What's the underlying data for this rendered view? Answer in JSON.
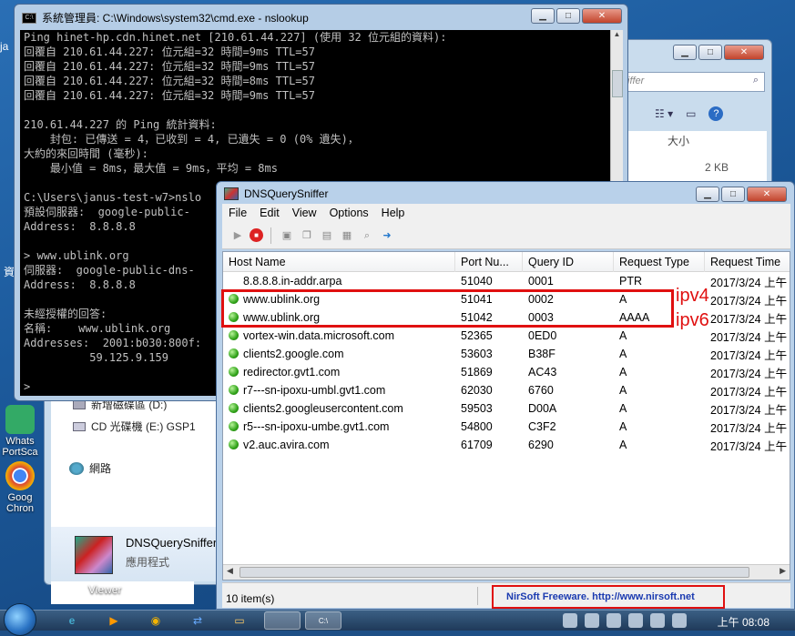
{
  "desktop": {
    "icons": [
      {
        "label": "Whats\nPortSca",
        "name": "whatsportscan-desktop-icon"
      },
      {
        "label": "Goog\nChron",
        "name": "google-chrome-desktop-icon"
      }
    ],
    "left_text": "ja",
    "left_text2": "資"
  },
  "explorer": {
    "search_placeholder": "iffer",
    "column_size": "大小",
    "size_value": "2 KB",
    "nav_items": [
      "新增磁碟區 (D:)",
      "CD 光碟機 (E:) GSP1",
      "網路"
    ],
    "detail_name": "DNSQuerySniffer",
    "detail_type": "應用程式",
    "viewer_label": "Viewer"
  },
  "cmd": {
    "title": "系統管理員: C:\\Windows\\system32\\cmd.exe - nslookup",
    "icon_text": "C:\\",
    "lines": [
      "Ping hinet-hp.cdn.hinet.net [210.61.44.227] (使用 32 位元組的資料):",
      "回覆自 210.61.44.227: 位元組=32 時間=9ms TTL=57",
      "回覆自 210.61.44.227: 位元組=32 時間=9ms TTL=57",
      "回覆自 210.61.44.227: 位元組=32 時間=8ms TTL=57",
      "回覆自 210.61.44.227: 位元組=32 時間=9ms TTL=57",
      "",
      "210.61.44.227 的 Ping 統計資料:",
      "    封包: 已傳送 = 4，已收到 = 4, 已遺失 = 0 (0% 遺失)，",
      "大約的來回時間 (毫秒):",
      "    最小值 = 8ms，最大值 = 9ms，平均 = 8ms",
      "",
      "C:\\Users\\janus-test-w7>nslo",
      "預設伺服器:  google-public-",
      "Address:  8.8.8.8",
      "",
      "> www.ublink.org",
      "伺服器:  google-public-dns-",
      "Address:  8.8.8.8",
      "",
      "未經授權的回答:",
      "名稱:    www.ublink.org",
      "Addresses:  2001:b030:800f:",
      "          59.125.9.159",
      "",
      ">"
    ]
  },
  "dqs": {
    "title": "DNSQuerySniffer",
    "menu": [
      "File",
      "Edit",
      "View",
      "Options",
      "Help"
    ],
    "columns": [
      "Host Name",
      "Port Nu...",
      "Query ID",
      "Request Type",
      "Request Time"
    ],
    "rows": [
      {
        "host": "8.8.8.8.in-addr.arpa",
        "port": "51040",
        "qid": "0001",
        "type": "PTR",
        "time": "2017/3/24 上午",
        "dot": false
      },
      {
        "host": "www.ublink.org",
        "port": "51041",
        "qid": "0002",
        "type": "A",
        "time": "2017/3/24 上午",
        "dot": true
      },
      {
        "host": "www.ublink.org",
        "port": "51042",
        "qid": "0003",
        "type": "AAAA",
        "time": "2017/3/24 上午",
        "dot": true
      },
      {
        "host": "vortex-win.data.microsoft.com",
        "port": "52365",
        "qid": "0ED0",
        "type": "A",
        "time": "2017/3/24 上午",
        "dot": true
      },
      {
        "host": "clients2.google.com",
        "port": "53603",
        "qid": "B38F",
        "type": "A",
        "time": "2017/3/24 上午",
        "dot": true
      },
      {
        "host": "redirector.gvt1.com",
        "port": "51869",
        "qid": "AC43",
        "type": "A",
        "time": "2017/3/24 上午",
        "dot": true
      },
      {
        "host": "r7---sn-ipoxu-umbl.gvt1.com",
        "port": "62030",
        "qid": "6760",
        "type": "A",
        "time": "2017/3/24 上午",
        "dot": true
      },
      {
        "host": "clients2.googleusercontent.com",
        "port": "59503",
        "qid": "D00A",
        "type": "A",
        "time": "2017/3/24 上午",
        "dot": true
      },
      {
        "host": "r5---sn-ipoxu-umbe.gvt1.com",
        "port": "54800",
        "qid": "C3F2",
        "type": "A",
        "time": "2017/3/24 上午",
        "dot": true
      },
      {
        "host": "v2.auc.avira.com",
        "port": "61709",
        "qid": "6290",
        "type": "A",
        "time": "2017/3/24 上午",
        "dot": true
      }
    ],
    "status_count": "10 item(s)",
    "nirsoft": "NirSoft Freeware.  http://www.nirsoft.net"
  },
  "annotations": {
    "ipv4": "ipv4",
    "ipv6": "ipv6",
    "color": "#e01010"
  },
  "taskbar": {
    "clock": "上午 08:08"
  }
}
